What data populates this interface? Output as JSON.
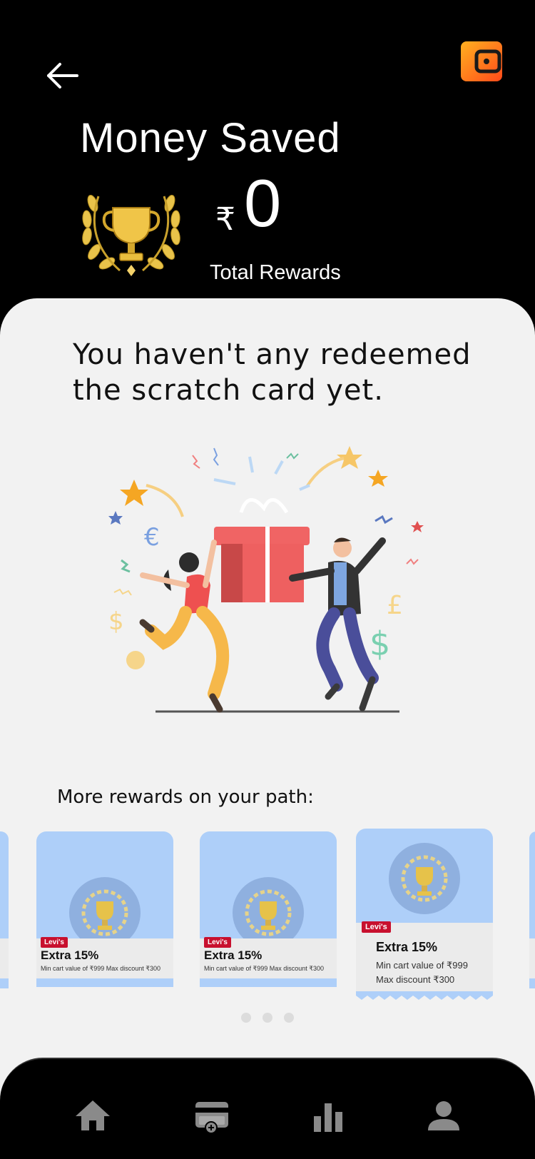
{
  "header": {
    "title": "Money Saved",
    "currency_symbol": "₹",
    "amount": "0",
    "rewards_label": "Total Rewards",
    "wallet_icon": "wallet-icon",
    "back_icon": "back-arrow-icon"
  },
  "empty_state": {
    "message": "You haven't any redeemed the scratch card yet."
  },
  "rewards": {
    "title": "More rewards on your path:",
    "cards": [
      {
        "brand": "Levi's",
        "offer": "Extra 15%",
        "description": "Min cart value of ₹999 Max discount ₹300"
      },
      {
        "brand": "Levi's",
        "offer": "Extra 15%",
        "description": "Min cart value of ₹999 Max discount ₹300"
      },
      {
        "brand": "Levi's",
        "offer": "Extra 15%",
        "description": "Min cart value of ₹999 Max discount ₹300"
      }
    ],
    "pagination_count": 3
  },
  "bottom_nav": {
    "items": [
      {
        "icon": "home-icon"
      },
      {
        "icon": "card-add-icon"
      },
      {
        "icon": "bar-chart-icon"
      },
      {
        "icon": "profile-icon"
      }
    ]
  },
  "colors": {
    "background": "#000000",
    "sheet": "#f2f2f2",
    "card_blue": "#aecff9",
    "badge_blue": "#8fb0df",
    "wallet_orange": "#ff6a1a",
    "nav_icon": "#8a8a8a"
  }
}
